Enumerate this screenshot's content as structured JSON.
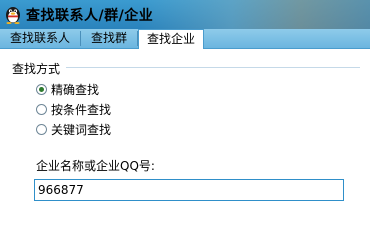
{
  "window": {
    "title": "查找联系人/群/企业"
  },
  "tabs": [
    {
      "label": "查找联系人",
      "active": false
    },
    {
      "label": "查找群",
      "active": false
    },
    {
      "label": "查找企业",
      "active": true
    }
  ],
  "search_method": {
    "title": "查找方式",
    "options": [
      {
        "label": "精确查找",
        "checked": true
      },
      {
        "label": "按条件查找",
        "checked": false
      },
      {
        "label": "关键词查找",
        "checked": false
      }
    ]
  },
  "company_field": {
    "label": "企业名称或企业QQ号:",
    "value": "966877"
  },
  "colors": {
    "titlebar": "#3b9bd0",
    "tabstrip": "#8ecbea",
    "input_border": "#2f8fc9",
    "radio_dot": "#2d7a2d"
  },
  "icons": {
    "title_icon": "qq-penguin-icon"
  }
}
